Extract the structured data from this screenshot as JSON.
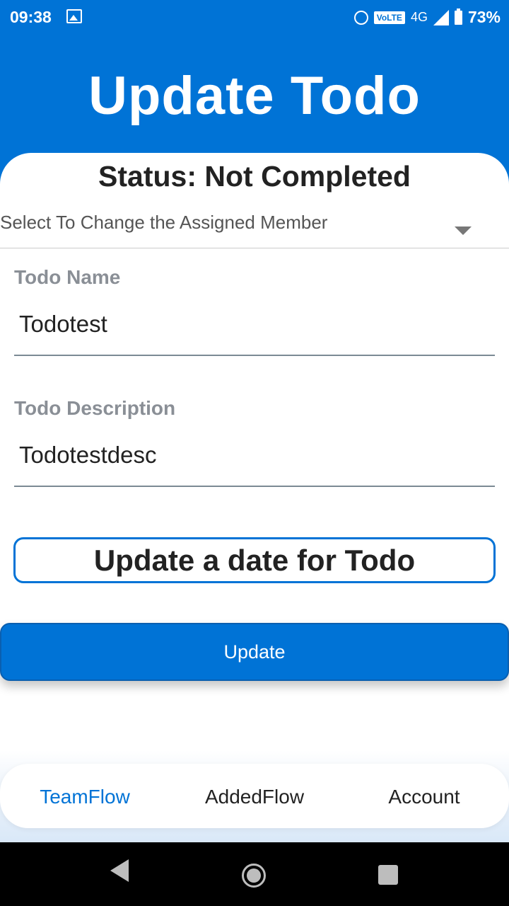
{
  "status_bar": {
    "time": "09:38",
    "volte": "VoLTE",
    "network": "4G",
    "battery": "73%"
  },
  "header": {
    "title": "Update Todo"
  },
  "status": {
    "text": "Status: Not Completed"
  },
  "assign_dropdown": {
    "placeholder": "Select To Change the Assigned Member"
  },
  "todo_name": {
    "label": "Todo Name",
    "value": "Todotest"
  },
  "todo_description": {
    "label": "Todo Description",
    "value": "Todotestdesc"
  },
  "date_button": {
    "label": "Update a date for Todo"
  },
  "update_button": {
    "label": "Update"
  },
  "bottom_nav": {
    "items": [
      {
        "label": "TeamFlow",
        "active": true
      },
      {
        "label": "AddedFlow",
        "active": false
      },
      {
        "label": "Account",
        "active": false
      }
    ]
  },
  "colors": {
    "accent": "#0073d6",
    "text": "#222222",
    "label_gray": "#8a8f96"
  }
}
